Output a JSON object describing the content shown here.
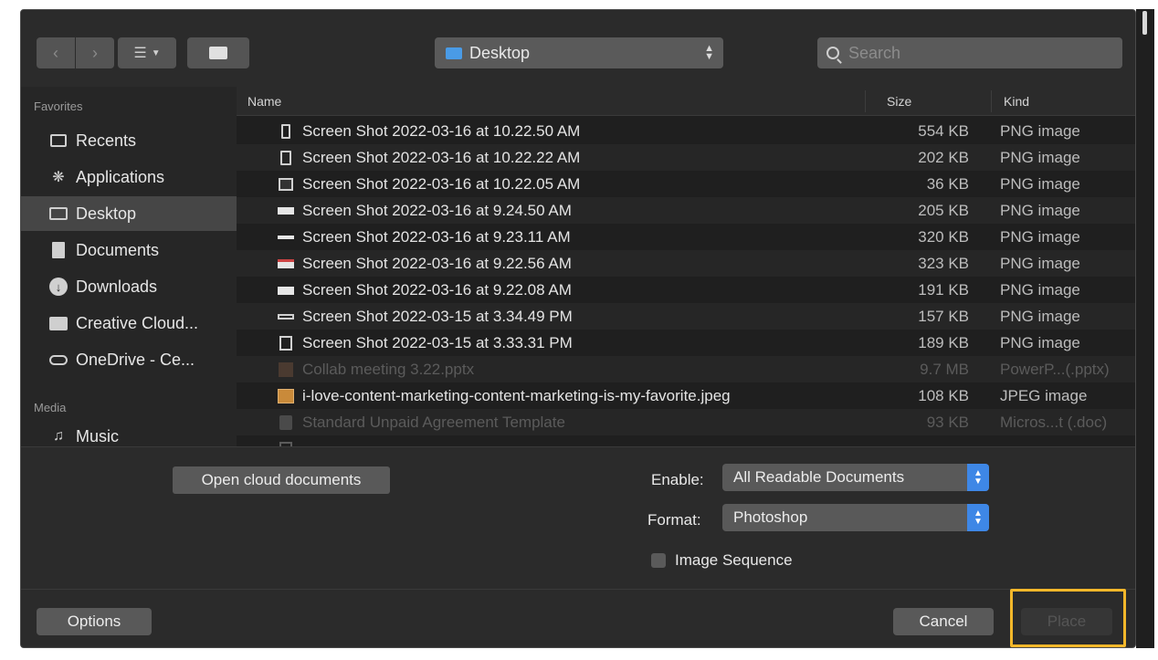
{
  "toolbar": {
    "location": "Desktop",
    "search_placeholder": "Search"
  },
  "sidebar": {
    "favorites_header": "Favorites",
    "favorites": [
      {
        "label": "Recents",
        "icon": "recents-icon"
      },
      {
        "label": "Applications",
        "icon": "applications-icon"
      },
      {
        "label": "Desktop",
        "icon": "desktop-icon",
        "selected": true
      },
      {
        "label": "Documents",
        "icon": "documents-icon"
      },
      {
        "label": "Downloads",
        "icon": "downloads-icon"
      },
      {
        "label": "Creative Cloud...",
        "icon": "folder-icon"
      },
      {
        "label": "OneDrive - Ce...",
        "icon": "cloud-icon"
      }
    ],
    "media_header": "Media",
    "media": [
      {
        "label": "Music",
        "icon": "music-icon"
      }
    ]
  },
  "columns": {
    "name": "Name",
    "size": "Size",
    "kind": "Kind"
  },
  "files": [
    {
      "name": "Screen Shot 2022-03-16 at 10.22.50 AM",
      "size": "554 KB",
      "kind": "PNG image",
      "enabled": true
    },
    {
      "name": "Screen Shot 2022-03-16 at 10.22.22 AM",
      "size": "202 KB",
      "kind": "PNG image",
      "enabled": true
    },
    {
      "name": "Screen Shot 2022-03-16 at 10.22.05 AM",
      "size": "36 KB",
      "kind": "PNG image",
      "enabled": true
    },
    {
      "name": "Screen Shot 2022-03-16 at 9.24.50 AM",
      "size": "205 KB",
      "kind": "PNG image",
      "enabled": true
    },
    {
      "name": "Screen Shot 2022-03-16 at 9.23.11 AM",
      "size": "320 KB",
      "kind": "PNG image",
      "enabled": true
    },
    {
      "name": "Screen Shot 2022-03-16 at 9.22.56 AM",
      "size": "323 KB",
      "kind": "PNG image",
      "enabled": true
    },
    {
      "name": "Screen Shot 2022-03-16 at 9.22.08 AM",
      "size": "191 KB",
      "kind": "PNG image",
      "enabled": true
    },
    {
      "name": "Screen Shot 2022-03-15 at 3.34.49 PM",
      "size": "157 KB",
      "kind": "PNG image",
      "enabled": true
    },
    {
      "name": "Screen Shot 2022-03-15 at 3.33.31 PM",
      "size": "189 KB",
      "kind": "PNG image",
      "enabled": true
    },
    {
      "name": "Collab meeting 3.22.pptx",
      "size": "9.7 MB",
      "kind": "PowerP...(.pptx)",
      "enabled": false
    },
    {
      "name": "i-love-content-marketing-content-marketing-is-my-favorite.jpeg",
      "size": "108 KB",
      "kind": "JPEG image",
      "enabled": true
    },
    {
      "name": "Standard Unpaid Agreement Template",
      "size": "93 KB",
      "kind": "Micros...t (.doc)",
      "enabled": false
    }
  ],
  "options": {
    "cloud_button": "Open cloud documents",
    "enable_label": "Enable:",
    "enable_value": "All Readable Documents",
    "format_label": "Format:",
    "format_value": "Photoshop",
    "image_sequence_label": "Image Sequence"
  },
  "footer": {
    "options_button": "Options",
    "cancel_button": "Cancel",
    "place_button": "Place"
  },
  "colors": {
    "accent": "#3e87e6",
    "highlight": "#f3b72a"
  }
}
